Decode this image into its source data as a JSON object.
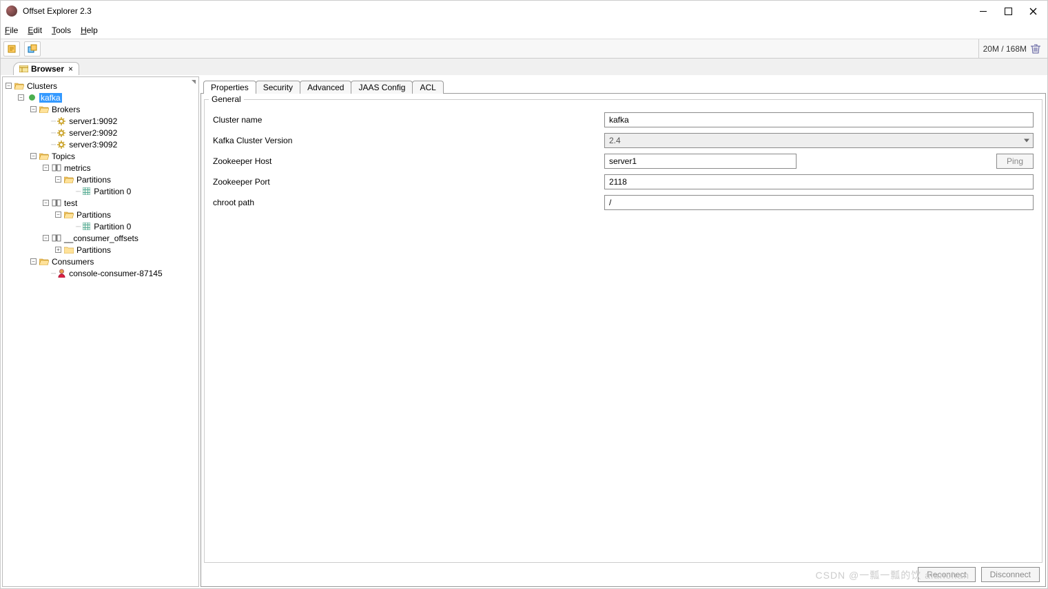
{
  "window": {
    "title": "Offset Explorer  2.3"
  },
  "menu": {
    "file": "File",
    "edit": "Edit",
    "tools": "Tools",
    "help": "Help"
  },
  "toolbar": {
    "memory": "20M / 168M"
  },
  "worktab": {
    "label": "Browser"
  },
  "tree": {
    "clusters": "Clusters",
    "kafka": "kafka",
    "brokers": "Brokers",
    "b1": "server1:9092",
    "b2": "server2:9092",
    "b3": "server3:9092",
    "topics": "Topics",
    "metrics": "metrics",
    "partitions": "Partitions",
    "p0": "Partition 0",
    "test": "test",
    "consumer_offsets": "__consumer_offsets",
    "consumers": "Consumers",
    "consumer1": "console-consumer-87145"
  },
  "tabs": {
    "properties": "Properties",
    "security": "Security",
    "advanced": "Advanced",
    "jaas": "JAAS Config",
    "acl": "ACL"
  },
  "general": {
    "legend": "General",
    "cluster_name_label": "Cluster name",
    "cluster_name": "kafka",
    "version_label": "Kafka Cluster Version",
    "version": "2.4",
    "zk_host_label": "Zookeeper Host",
    "zk_host": "server1",
    "ping": "Ping",
    "zk_port_label": "Zookeeper Port",
    "zk_port": "2118",
    "chroot_label": "chroot path",
    "chroot": "/"
  },
  "buttons": {
    "reconnect": "Reconnect",
    "disconnect": "Disconnect"
  },
  "watermark": "CSDN @一瓢一瓢的饮 alanchan"
}
